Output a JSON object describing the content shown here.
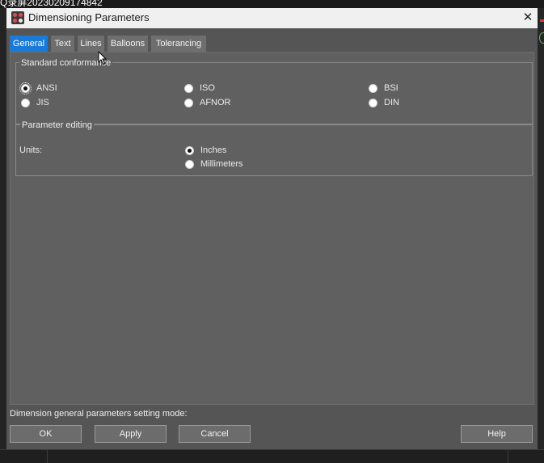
{
  "background": {
    "caption": "Q录屏20230209174842"
  },
  "dialog": {
    "title": "Dimensioning Parameters",
    "close_glyph": "✕",
    "tabs": [
      {
        "label": "General",
        "active": true
      },
      {
        "label": "Text",
        "active": false
      },
      {
        "label": "Lines",
        "active": false
      },
      {
        "label": "Balloons",
        "active": false
      },
      {
        "label": "Tolerancing",
        "active": false
      }
    ],
    "standard_conformance": {
      "title": "Standard conformance",
      "options": [
        {
          "label": "ANSI",
          "selected": true
        },
        {
          "label": "ISO",
          "selected": false
        },
        {
          "label": "BSI",
          "selected": false
        },
        {
          "label": "JIS",
          "selected": false
        },
        {
          "label": "AFNOR",
          "selected": false
        },
        {
          "label": "DIN",
          "selected": false
        }
      ]
    },
    "parameter_editing": {
      "title": "Parameter editing",
      "units_label": "Units:",
      "units": [
        {
          "label": "Inches",
          "selected": true
        },
        {
          "label": "Millimeters",
          "selected": false
        }
      ]
    },
    "mode_text": "Dimension general parameters setting mode:",
    "buttons": {
      "ok": "OK",
      "apply": "Apply",
      "cancel": "Cancel",
      "help": "Help"
    }
  },
  "colors": {
    "active_tab": "#1a7ad7",
    "dialog_bg": "#555555",
    "panel_bg": "#606060",
    "titlebar_bg": "#f0f0f0"
  },
  "icons": [
    "app-icon",
    "close-icon",
    "mouse-pointer-icon"
  ]
}
